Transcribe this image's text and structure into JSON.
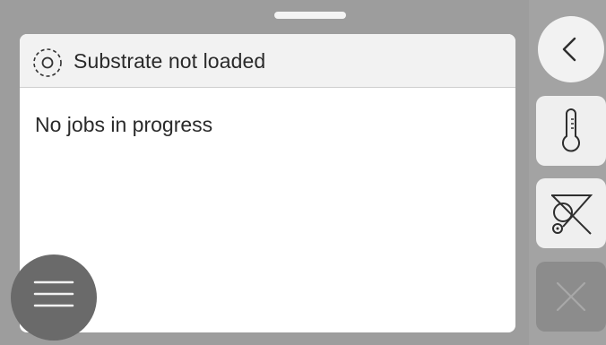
{
  "header": {
    "title": "Substrate not loaded",
    "icon": "substrate-status-icon"
  },
  "main": {
    "status_text": "No jobs in progress"
  },
  "sidebar": {
    "buttons": [
      {
        "icon": "back-chevron-icon",
        "enabled": true
      },
      {
        "icon": "thermometer-icon",
        "enabled": true
      },
      {
        "icon": "substrate-path-disabled-icon",
        "enabled": true
      },
      {
        "icon": "close-icon",
        "enabled": false
      }
    ]
  },
  "menu": {
    "icon": "hamburger-menu-icon"
  },
  "colors": {
    "background": "#9d9d9d",
    "panel": "#ffffff",
    "header": "#f2f2f2",
    "menu_button": "#6a6a6a",
    "disabled_button": "#8c8c8c"
  }
}
